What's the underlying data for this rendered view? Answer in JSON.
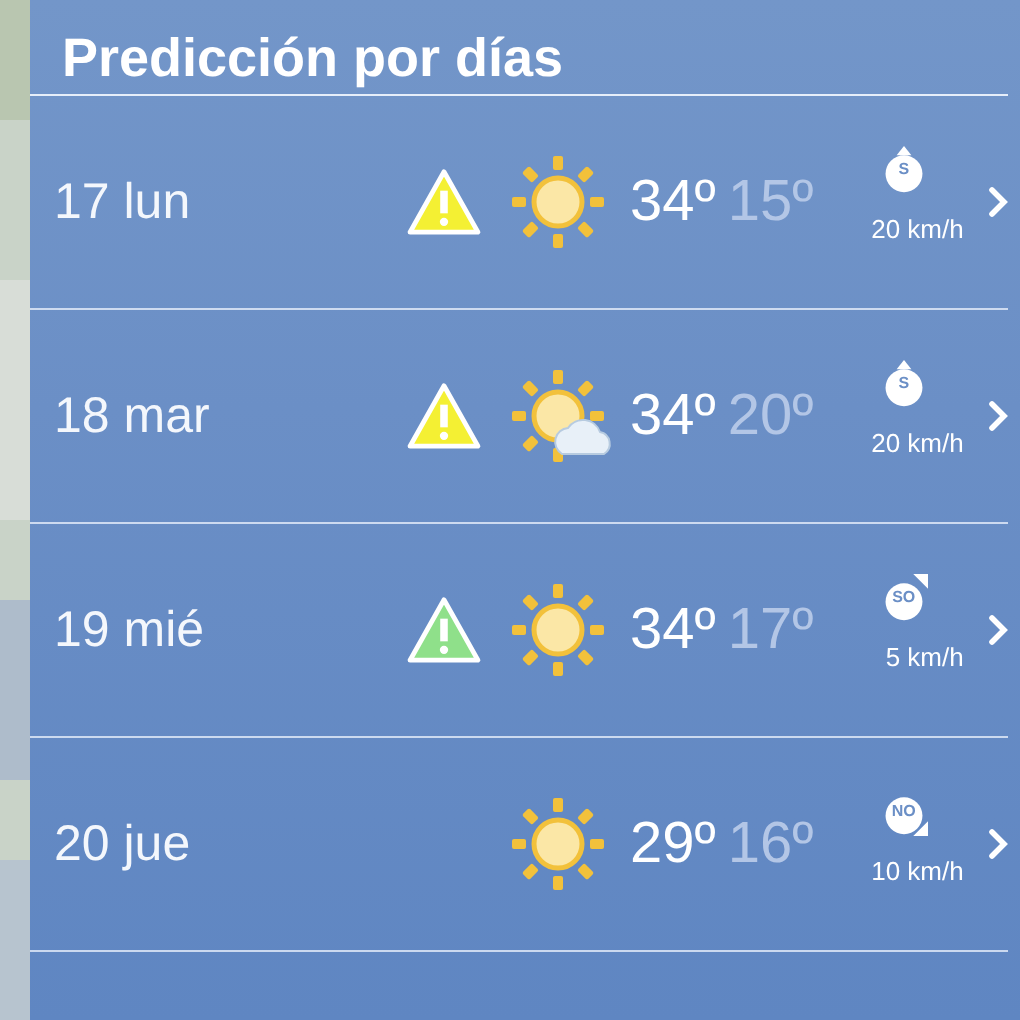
{
  "title": "Predicción por días",
  "days": [
    {
      "date": "17 lun",
      "alert": {
        "color": "#f4f033"
      },
      "weather": {
        "kind": "sun"
      },
      "max": "34º",
      "min": "15º",
      "wind": {
        "dir": "S",
        "kind": "up",
        "speed": "20 km/h"
      }
    },
    {
      "date": "18 mar",
      "alert": {
        "color": "#f4f033"
      },
      "weather": {
        "kind": "sun-cloud"
      },
      "max": "34º",
      "min": "20º",
      "wind": {
        "dir": "S",
        "kind": "up",
        "speed": "20 km/h"
      }
    },
    {
      "date": "19 mié",
      "alert": {
        "color": "#8fe08a"
      },
      "weather": {
        "kind": "sun"
      },
      "max": "34º",
      "min": "17º",
      "wind": {
        "dir": "SO",
        "kind": "upright",
        "speed": "5 km/h"
      }
    },
    {
      "date": "20 jue",
      "weather": {
        "kind": "sun"
      },
      "max": "29º",
      "min": "16º",
      "wind": {
        "dir": "NO",
        "kind": "downright",
        "speed": "10 km/h"
      }
    }
  ]
}
